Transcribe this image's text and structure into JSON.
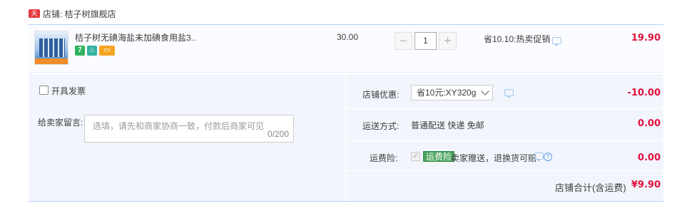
{
  "store": {
    "tag": "天猫",
    "name": "店铺: 桔子树旗舰店"
  },
  "item": {
    "title": "桔子树无碘海盐未加碘食用盐3...",
    "badges": [
      "7",
      "♨",
      "▭"
    ],
    "unit_price": "30.00",
    "quantity": "1",
    "minus": "−",
    "plus": "+",
    "promotion": "省10.10:热卖促销",
    "subtotal": "19.90"
  },
  "invoice": {
    "label": "开具发票"
  },
  "message": {
    "label": "给卖家留言:",
    "placeholder": "选填，请先和商家协商一致，付款后商家可见",
    "counter": "0/200"
  },
  "discount": {
    "label": "店铺优惠:",
    "selected": "省10元:XY320g",
    "amount": "-10.00"
  },
  "shipping": {
    "label": "运送方式:",
    "value": "普通配送 快递 免邮",
    "amount": "0.00"
  },
  "insurance": {
    "label": "运费险:",
    "check": "✓",
    "tag": "运费险",
    "text": "卖家赠送，退换货可赔",
    "help": "?",
    "amount": "0.00"
  },
  "total": {
    "label": "店铺合计(含运费)",
    "value": "¥9.90"
  },
  "colors": {
    "accent_price": "#e0103d",
    "panel_bg": "#f2f6fc",
    "row_border": "#b2d1ff",
    "insurance_tag": "#4aa35c"
  }
}
